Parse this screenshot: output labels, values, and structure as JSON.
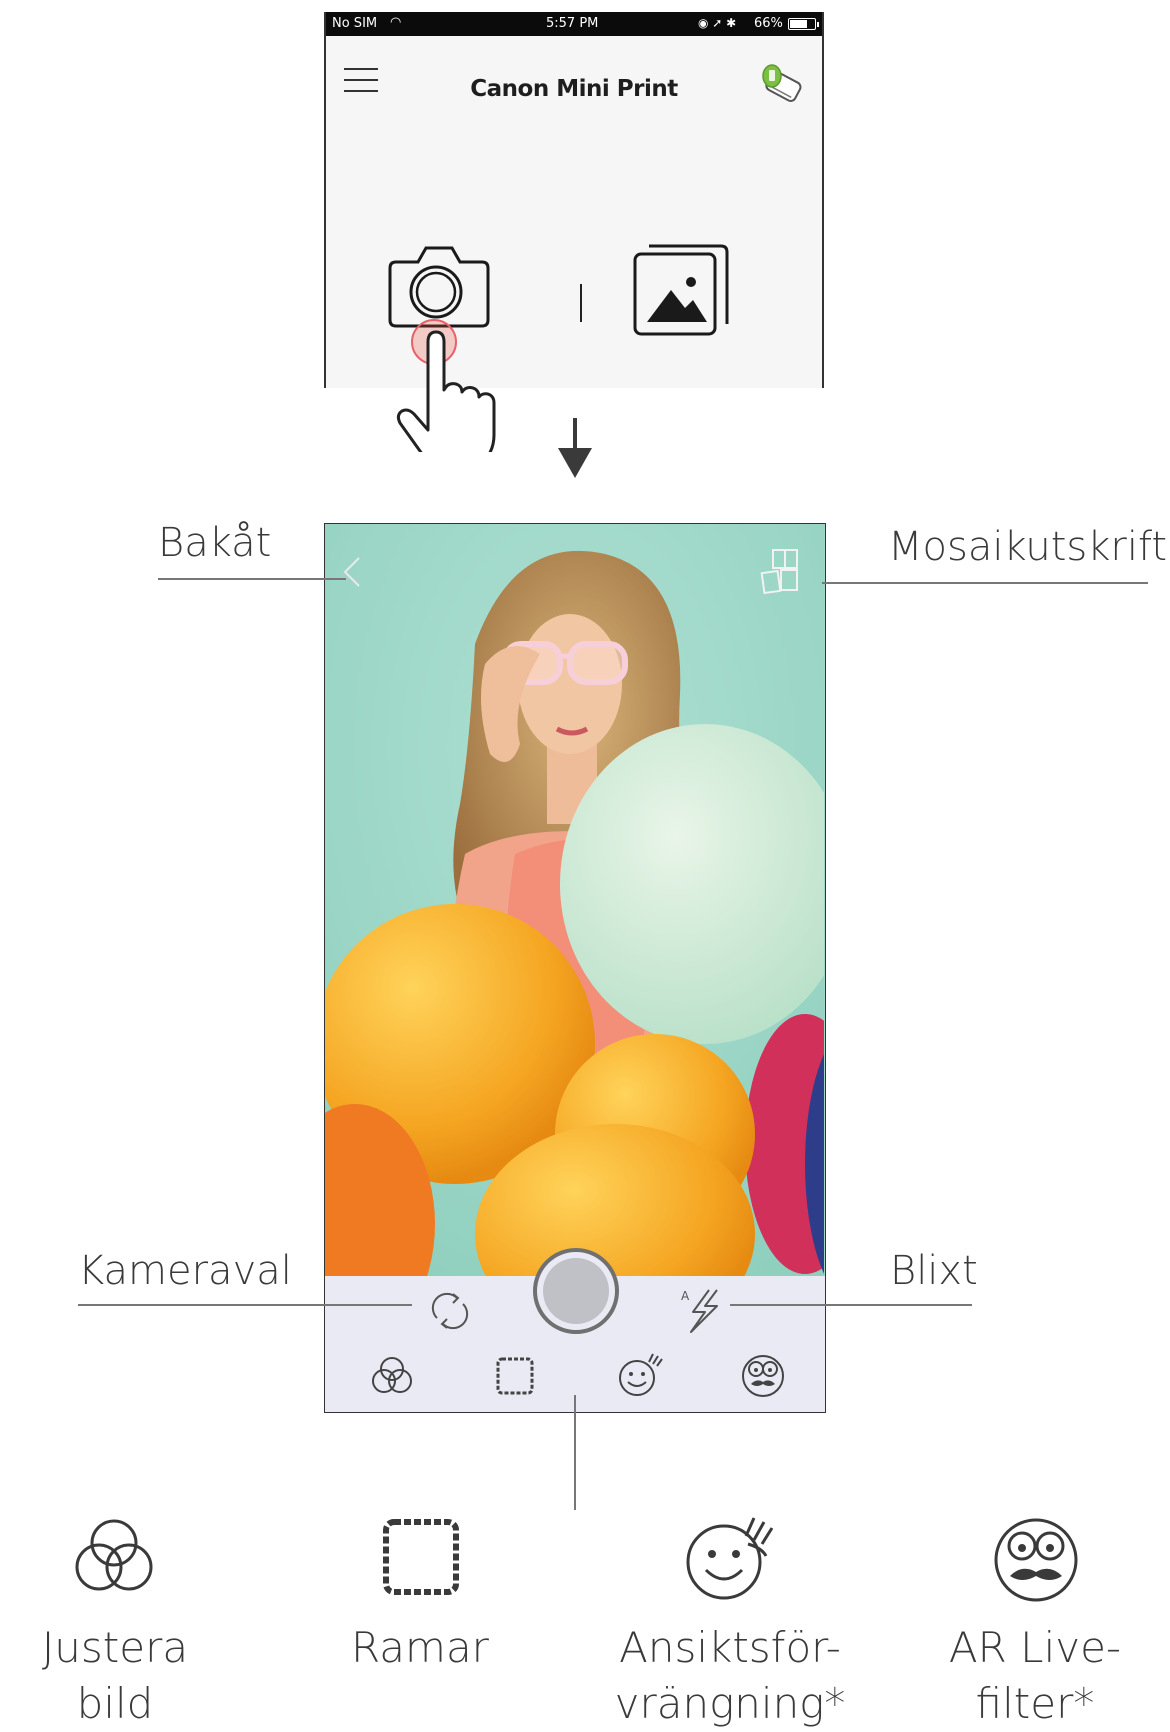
{
  "status_bar": {
    "carrier": "No SIM",
    "time": "5:57 PM",
    "battery": "66%"
  },
  "app": {
    "title": "Canon Mini Print"
  },
  "callouts": {
    "back": "Bakåt",
    "mosaic": "Mosaikutskrift",
    "camera_select": "Kameraval",
    "flash": "Blixt"
  },
  "features": [
    {
      "icon": "adjust-image-icon",
      "label": "Justera bild"
    },
    {
      "icon": "frame-icon",
      "label": "Ramar"
    },
    {
      "icon": "face-distortion-icon",
      "label_line1": "Ansiktsför-",
      "label_line2": "vrängning*"
    },
    {
      "icon": "ar-filter-icon",
      "label": "AR Live-filter*"
    }
  ]
}
